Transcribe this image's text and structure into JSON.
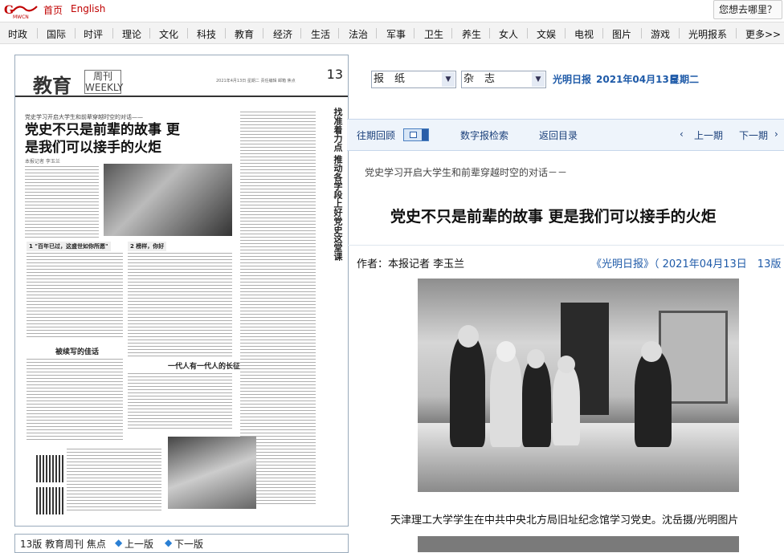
{
  "top": {
    "home": "首页",
    "english": "English",
    "where": "您想去哪里？"
  },
  "nav": {
    "items": [
      "时政",
      "国际",
      "时评",
      "理论",
      "文化",
      "科技",
      "教育",
      "经济",
      "生活",
      "法治",
      "军事",
      "卫生",
      "养生",
      "女人",
      "文娱",
      "电视",
      "图片",
      "游戏",
      "光明报系",
      "更多>>"
    ]
  },
  "paper": {
    "section": "教育",
    "weekly": "周刊 WEEKLY",
    "page_no": "13",
    "meta": "2021年4月13日 星期二 责任编辑 邮箱 焦点",
    "subhead": "党史学习开启大学生和前辈穿越时空的对话——",
    "headline": "党史不只是前辈的故事 更是我们可以接手的火炬",
    "byline": "本报记者 李玉兰",
    "vertical_title": "找准着力点 推动各学段上好党史这堂课",
    "box1": "1  \"百年已过，这盛世如你所愿\"",
    "box2": "2  榜样，你好",
    "mid1": "被续写的佳话",
    "mid2": "一代人有一代人的长征"
  },
  "pager": {
    "label": "13版 教育周刊 焦点",
    "prev": "上一版",
    "next": "下一版"
  },
  "selects": {
    "paper": "报　纸",
    "magazine": "杂　志"
  },
  "paper_date": {
    "name": "光明日报",
    "date": "2021年04月13日",
    "weekday": "星期二"
  },
  "toolbar": {
    "archive": "往期回顾",
    "search": "数字报检索",
    "back": "返回目录",
    "prev": "上一期",
    "next": "下一期"
  },
  "article": {
    "subtitle": "党史学习开启大学生和前辈穿越时空的对话－－",
    "title": "党史不只是前辈的故事 更是我们可以接手的火炬",
    "author": "作者：本报记者 李玉兰",
    "source": "《光明日报》（ 2021年04月13日　13版",
    "caption": "天津理工大学学生在中共中央北方局旧址纪念馆学习党史。沈岳摄/光明图片"
  },
  "colors": {
    "brand_red": "#c00000",
    "link_blue": "#1e5aa8"
  }
}
